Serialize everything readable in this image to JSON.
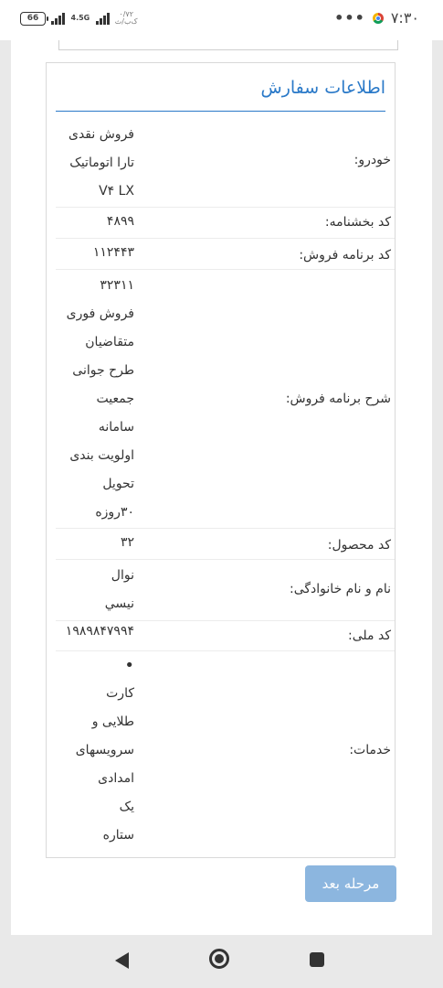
{
  "status_bar": {
    "time": "۷:۳۰",
    "battery": "66",
    "network": "4.5G",
    "speed": "۰/۷۲",
    "speed_unit": "ک‌ب/ث",
    "more": "•••"
  },
  "panel": {
    "title": "اطلاعات سفارش",
    "rows": [
      {
        "label": "خودرو:",
        "values": [
          "فروش نقدی",
          "تارا اتوماتیک",
          "V۴ LX"
        ]
      },
      {
        "label": "کد بخشنامه:",
        "values": [
          "۴۸۹۹"
        ]
      },
      {
        "label": "کد برنامه فروش:",
        "values": [
          "۱۱۲۴۴۳"
        ]
      },
      {
        "label": "شرح برنامه فروش:",
        "values": [
          "۳۲۳۱۱",
          "فروش فوری",
          "متقاضیان",
          "طرح جوانی",
          "جمعیت",
          "سامانه",
          "اولویت بندی",
          "تحویل",
          "۳۰روزه"
        ]
      },
      {
        "label": "کد محصول:",
        "values": [
          "۳۲"
        ]
      },
      {
        "label": "نام و نام خانوادگی:",
        "values": [
          "نوال",
          "نیسي"
        ]
      },
      {
        "label": "کد ملی:",
        "values": [
          "۱۹۸۹۸۴۷۹۹۴"
        ]
      },
      {
        "label": "خدمات:",
        "values": [
          "•",
          "کارت",
          "طلایی و",
          "سرویسهای",
          "امدادی",
          "یک",
          "ستاره"
        ]
      }
    ]
  },
  "next_button": "مرحله بعد",
  "nav": {
    "back_icon": "back-triangle",
    "home_icon": "home-circle",
    "recent_icon": "recent-square"
  }
}
